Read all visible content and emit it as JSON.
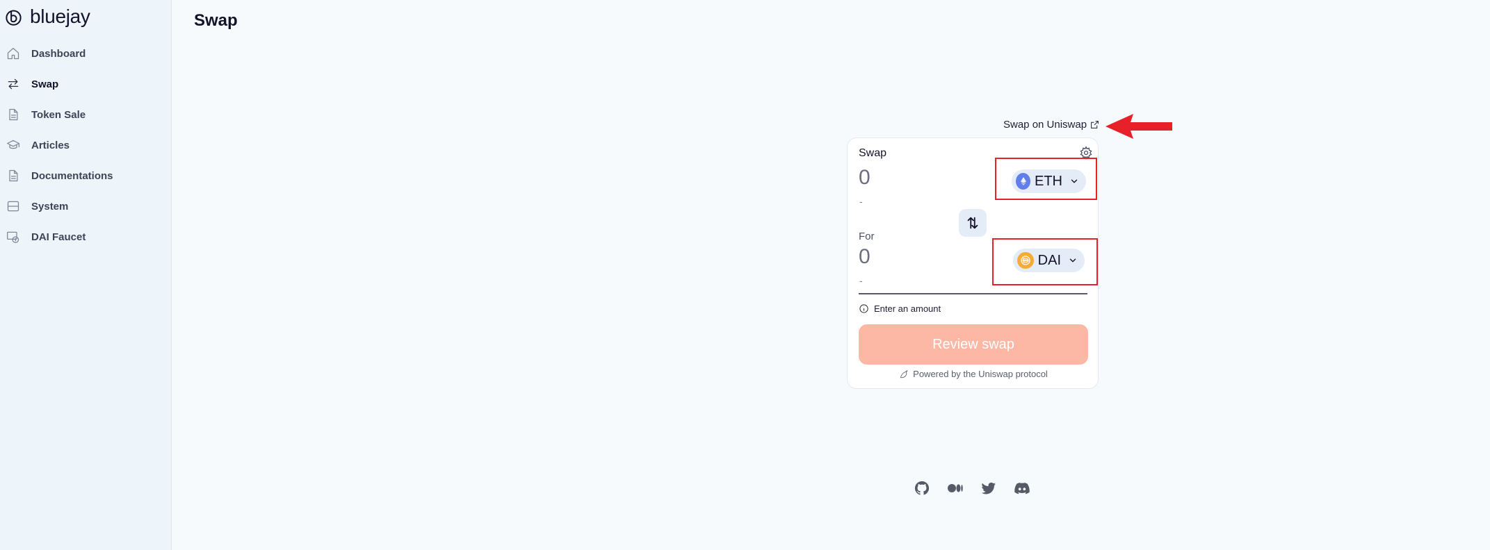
{
  "brand": {
    "name": "bluejay",
    "icon": "bluejay-logo-icon"
  },
  "sidebar": {
    "items": [
      {
        "label": "Dashboard",
        "icon": "home-icon",
        "active": false
      },
      {
        "label": "Swap",
        "icon": "swap-arrows-icon",
        "active": true
      },
      {
        "label": "Token Sale",
        "icon": "document-icon",
        "active": false
      },
      {
        "label": "Articles",
        "icon": "graduation-cap-icon",
        "active": false
      },
      {
        "label": "Documentations",
        "icon": "document-icon",
        "active": false
      },
      {
        "label": "System",
        "icon": "server-icon",
        "active": false
      },
      {
        "label": "DAI Faucet",
        "icon": "faucet-icon",
        "active": false
      }
    ]
  },
  "main": {
    "title": "Swap",
    "uniswap_link": "Swap on Uniswap"
  },
  "swap_card": {
    "title": "Swap",
    "from": {
      "amount": "0",
      "usd": "-",
      "token": "ETH"
    },
    "for_label": "For",
    "to": {
      "amount": "0",
      "usd": "-",
      "token": "DAI"
    },
    "status": "Enter an amount",
    "review_button": "Review swap",
    "powered_by": "Powered by the Uniswap protocol"
  },
  "footer": {
    "social": [
      "github-icon",
      "medium-icon",
      "twitter-icon",
      "discord-icon"
    ]
  },
  "colors": {
    "highlight": "#e8202a",
    "review_button": "#fdb7a5",
    "eth": "#627eea",
    "dai": "#f5ac37",
    "token_bg": "#e3ecf7"
  }
}
